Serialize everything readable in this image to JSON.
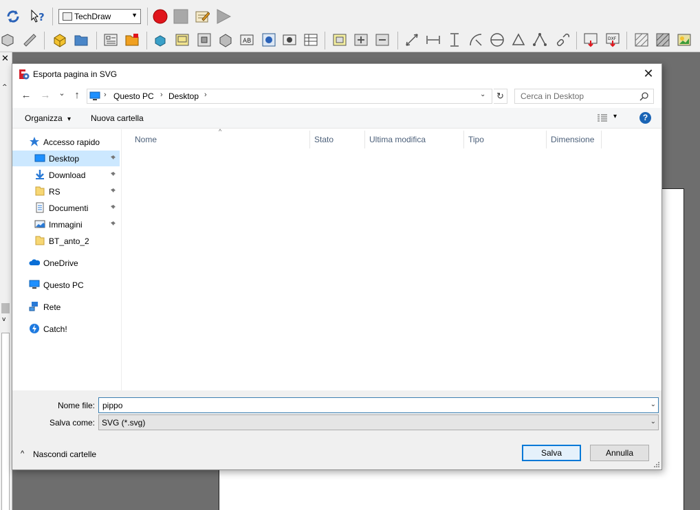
{
  "app": {
    "workbench_selector": {
      "value": "TechDraw"
    }
  },
  "dialog": {
    "title": "Esporta pagina in SVG",
    "close_glyph": "✕",
    "nav": {
      "back_glyph": "←",
      "forward_glyph": "→",
      "recent_glyph": "⌄",
      "up_glyph": "↑",
      "breadcrumb": [
        "Questo PC",
        "Desktop"
      ],
      "chevron": "›",
      "dropdown_glyph": "⌄",
      "refresh_glyph": "↻",
      "search_placeholder": "Cerca in Desktop"
    },
    "commands": {
      "organize_label": "Organizza",
      "organize_arrow": "▾",
      "new_folder_label": "Nuova cartella",
      "view_arrow": "▾",
      "help_glyph": "?"
    },
    "sidebar": {
      "items": [
        {
          "label": "Accesso rapido",
          "icon": "star-icon",
          "pinned": false,
          "selected": false
        },
        {
          "label": "Desktop",
          "icon": "desktop-folder-icon",
          "pinned": true,
          "selected": true
        },
        {
          "label": "Download",
          "icon": "download-arrow-icon",
          "pinned": true,
          "selected": false
        },
        {
          "label": "RS",
          "icon": "folder-icon",
          "pinned": true,
          "selected": false
        },
        {
          "label": "Documenti",
          "icon": "documents-icon",
          "pinned": true,
          "selected": false
        },
        {
          "label": "Immagini",
          "icon": "pictures-icon",
          "pinned": true,
          "selected": false
        },
        {
          "label": "BT_anto_2",
          "icon": "folder-icon",
          "pinned": false,
          "selected": false
        },
        {
          "label": "OneDrive",
          "icon": "onedrive-cloud-icon",
          "pinned": false,
          "selected": false
        },
        {
          "label": "Questo PC",
          "icon": "computer-icon",
          "pinned": false,
          "selected": false
        },
        {
          "label": "Rete",
          "icon": "network-icon",
          "pinned": false,
          "selected": false
        },
        {
          "label": "Catch!",
          "icon": "catch-icon",
          "pinned": false,
          "selected": false
        }
      ]
    },
    "file_list": {
      "sort_glyph": "^",
      "columns": [
        "Nome",
        "Stato",
        "Ultima modifica",
        "Tipo",
        "Dimensione"
      ],
      "rows": []
    },
    "form": {
      "filename_label": "Nome file:",
      "filename_value": "pippo",
      "filetype_label": "Salva come:",
      "filetype_value": "SVG (*.svg)",
      "dropdown_glyph": "⌄"
    },
    "footer": {
      "hide_folders_glyph": "^",
      "hide_folders_label": "Nascondi cartelle",
      "save_label": "Salva",
      "cancel_label": "Annulla"
    }
  },
  "colors": {
    "accent_blue": "#0078d7",
    "selection": "#cce8ff",
    "column_header_text": "#4c607a",
    "record_red": "#e0151c"
  }
}
